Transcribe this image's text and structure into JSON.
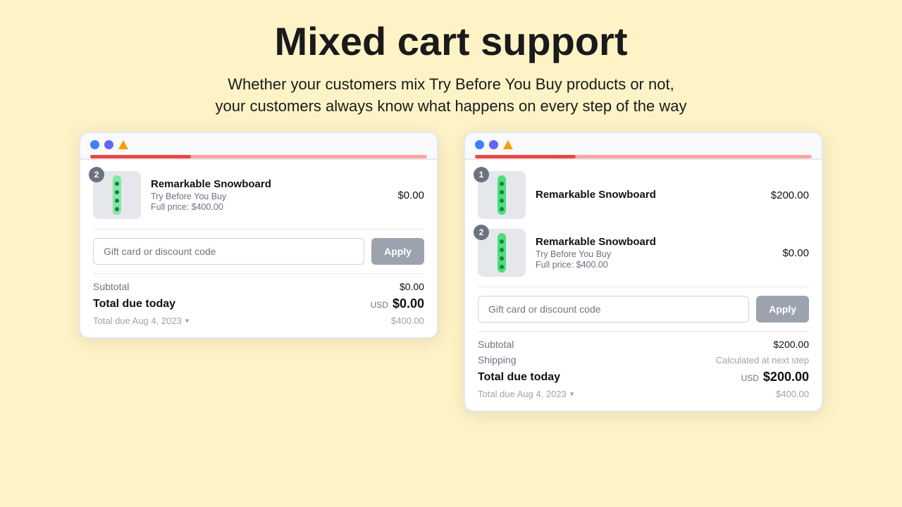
{
  "hero": {
    "title": "Mixed cart support",
    "subtitle_line1": "Whether your customers mix Try Before You Buy products or not,",
    "subtitle_line2": "your customers always know what happens on every step of the way"
  },
  "cart_left": {
    "product": {
      "badge": "2",
      "name": "Remarkable Snowboard",
      "tag": "Try Before You Buy",
      "full_price_label": "Full price: $400.00",
      "price": "$0.00"
    },
    "discount_placeholder": "Gift card or discount code",
    "apply_label": "Apply",
    "subtotal_label": "Subtotal",
    "subtotal_value": "$0.00",
    "total_label": "Total due today",
    "total_currency": "USD",
    "total_value": "$0.00",
    "future_due_label": "Total due Aug 4, 2023",
    "future_due_value": "$400.00"
  },
  "cart_right": {
    "product1": {
      "badge": "1",
      "name": "Remarkable Snowboard",
      "price": "$200.00"
    },
    "product2": {
      "badge": "2",
      "name": "Remarkable Snowboard",
      "tag": "Try Before You Buy",
      "full_price_label": "Full price: $400.00",
      "price": "$0.00"
    },
    "discount_placeholder": "Gift card or discount code",
    "apply_label": "Apply",
    "subtotal_label": "Subtotal",
    "subtotal_value": "$200.00",
    "shipping_label": "Shipping",
    "shipping_value": "Calculated at next step",
    "total_label": "Total due today",
    "total_currency": "USD",
    "total_value": "$200.00",
    "future_due_label": "Total due Aug 4, 2023",
    "future_due_value": "$400.00"
  },
  "colors": {
    "accent": "#ef4444",
    "badge_bg": "#6b7280",
    "apply_bg": "#9ca3af"
  }
}
